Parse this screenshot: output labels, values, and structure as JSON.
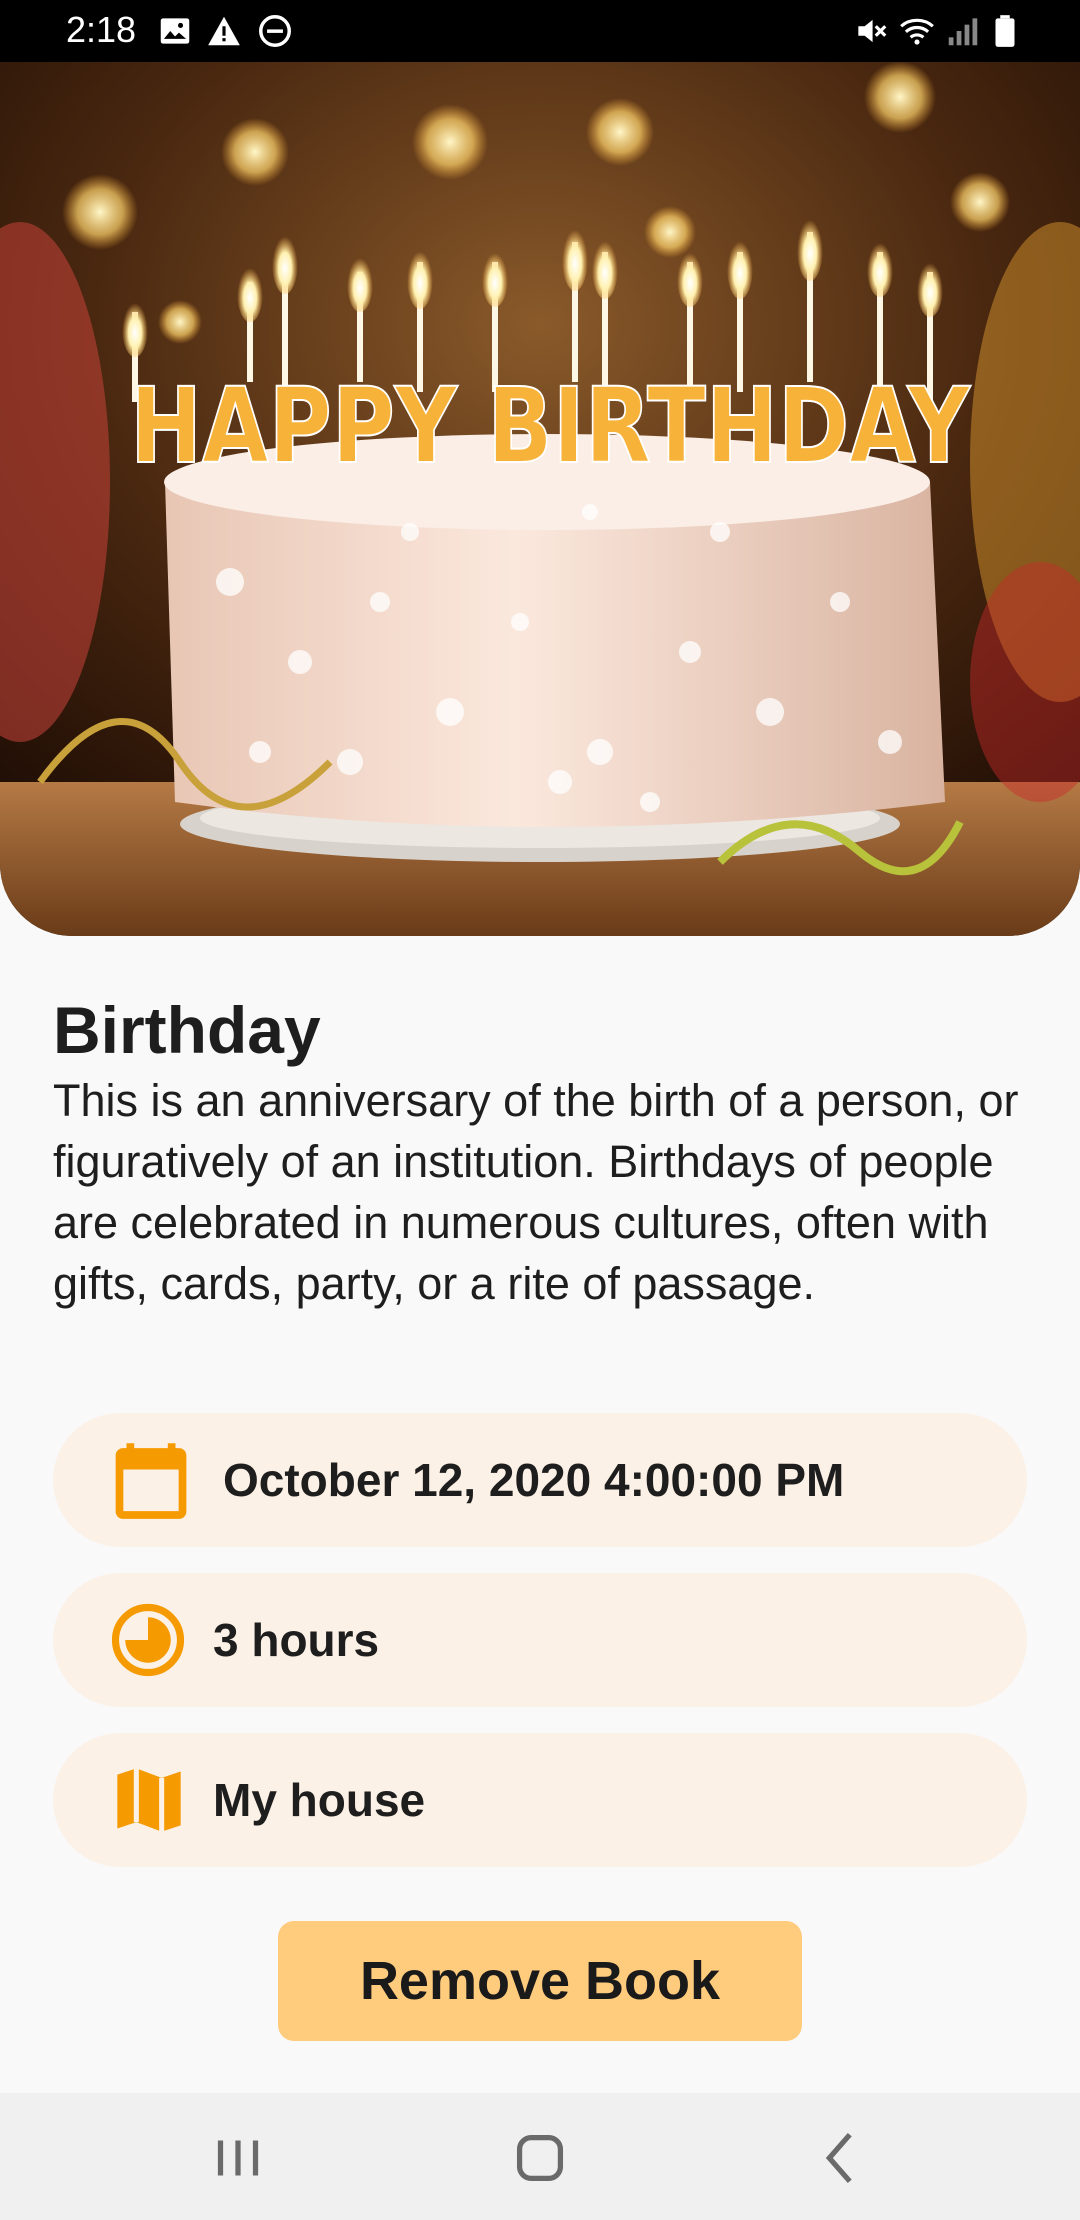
{
  "status_bar": {
    "time": "2:18",
    "left_icons": [
      "image-icon",
      "warning-icon",
      "do-not-disturb-icon"
    ],
    "right_icons": [
      "mute-icon",
      "wifi-icon",
      "signal-icon",
      "battery-icon"
    ]
  },
  "hero": {
    "image_name": "birthday-cake-photo",
    "candle_text": "HAPPY BIRTHDAY"
  },
  "event": {
    "title": "Birthday",
    "description": "This is an anniversary of the birth of a person, or figuratively of an institution. Birthdays of people are celebrated in numerous cultures, often with gifts, cards, party, or a rite of passage."
  },
  "details": {
    "date": "October 12, 2020 4:00:00 PM",
    "duration": "3 hours",
    "location": "My house"
  },
  "actions": {
    "remove_label": "Remove Book"
  },
  "colors": {
    "accent": "#f59a00",
    "card_bg": "#fcf1e6",
    "button_bg": "#ffcb7d"
  },
  "nav_bar": {
    "icons": [
      "recent-apps-icon",
      "home-icon",
      "back-icon"
    ]
  }
}
